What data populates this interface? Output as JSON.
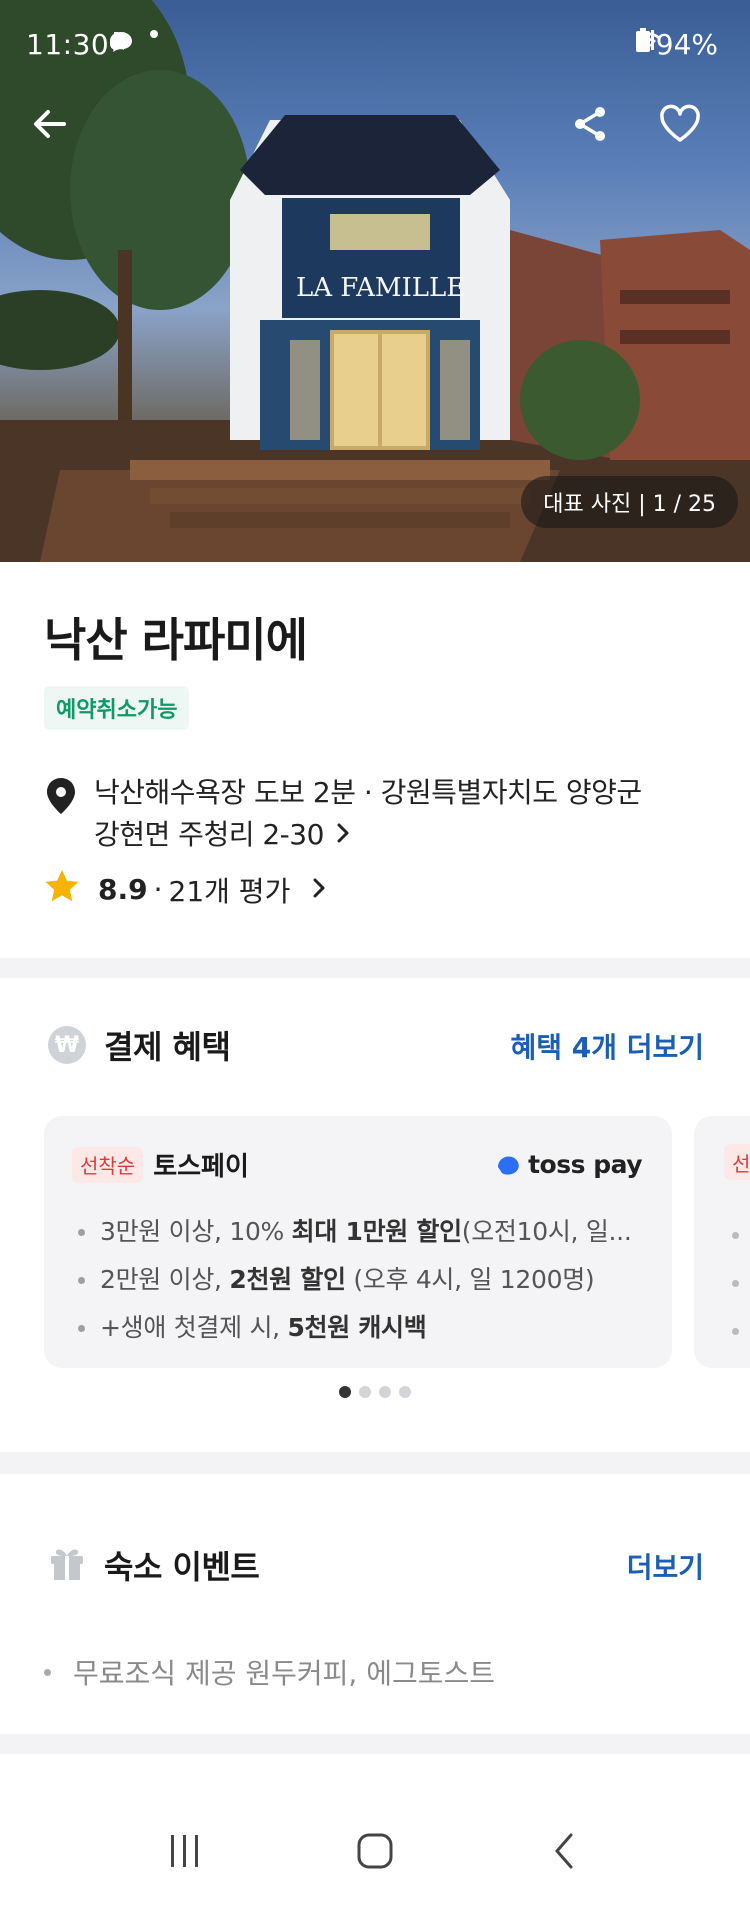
{
  "status_bar": {
    "time": "11:30",
    "battery": "94%"
  },
  "hero": {
    "sign_text": "LA FAMILLE",
    "photo_counter": "대표 사진 | 1 / 25"
  },
  "listing": {
    "title": "낙산 라파미에",
    "cancel_badge": "예약취소가능",
    "location_line1": "낙산해수욕장 도보 2분 · 강원특별자치도 양양군",
    "location_line2": "강현면 주청리 2-30",
    "rating_score": "8.9",
    "rating_sep": "·",
    "rating_count": "21개 평가"
  },
  "benefits": {
    "icon_label": "₩",
    "title": "결제 혜택",
    "more": "혜택 4개 더보기",
    "card": {
      "badge": "선착순",
      "provider": "토스페이",
      "logo_text": "toss pay",
      "items": [
        {
          "pre": "3만원 이상, 10% ",
          "bold": "최대 1만원 할인",
          "post": "(오전10시, 일..."
        },
        {
          "pre": "2만원 이상, ",
          "bold": "2천원 할인",
          "post": " (오후 4시, 일 1200명)"
        },
        {
          "pre": "+생애 첫결제 시, ",
          "bold": "5천원 캐시백",
          "post": ""
        }
      ]
    },
    "peek_badge": "선"
  },
  "events": {
    "title": "숙소 이벤트",
    "more": "더보기",
    "item": "무료조식 제공 원두커피, 에그토스트"
  },
  "colors": {
    "accent_blue": "#1a5fb4",
    "cancel_green": "#0e9a67",
    "first_red": "#e03a3a",
    "star": "#f5b400"
  }
}
